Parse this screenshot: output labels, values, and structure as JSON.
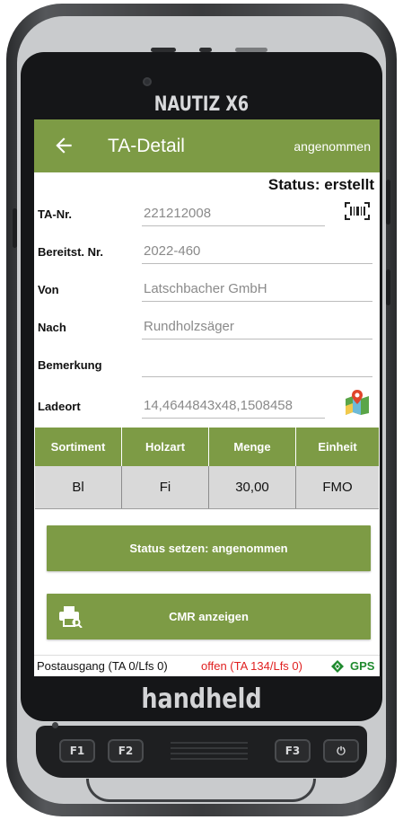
{
  "device": {
    "brand_top": "NAUTIZ X6",
    "brand_bottom": "handheld",
    "keys": [
      "F1",
      "F2",
      "F3",
      "⏻"
    ]
  },
  "appbar": {
    "title": "TA-Detail",
    "status": "angenommen",
    "color": "#7d9b45"
  },
  "status_line": "Status: erstellt",
  "fields": [
    {
      "label": "TA-Nr.",
      "value": "221212008"
    },
    {
      "label": "Bereitst. Nr.",
      "value": "2022-460"
    },
    {
      "label": "Von",
      "value": "Latschbacher GmbH"
    },
    {
      "label": "Nach",
      "value": "Rundholzsäger"
    },
    {
      "label": "Bemerkung",
      "value": ""
    },
    {
      "label": "Ladeort",
      "value": "14,4644843x48,1508458"
    }
  ],
  "table": {
    "headers": [
      "Sortiment",
      "Holzart",
      "Menge",
      "Einheit"
    ],
    "rows": [
      [
        "Bl",
        "Fi",
        "30,00",
        "FMO"
      ]
    ]
  },
  "buttons": {
    "status": "Status setzen: angenommen",
    "cmr": "CMR anzeigen"
  },
  "statusbar": {
    "postausgang": "Postausgang (TA 0/Lfs 0)",
    "offen": "offen (TA 134/Lfs 0)",
    "gps": "GPS"
  },
  "icons": {
    "back": "arrow-left-icon",
    "barcode": "barcode-scan-icon",
    "map": "map-pin-icon",
    "printer": "printer-icon",
    "gps": "gps-diamond-icon"
  }
}
